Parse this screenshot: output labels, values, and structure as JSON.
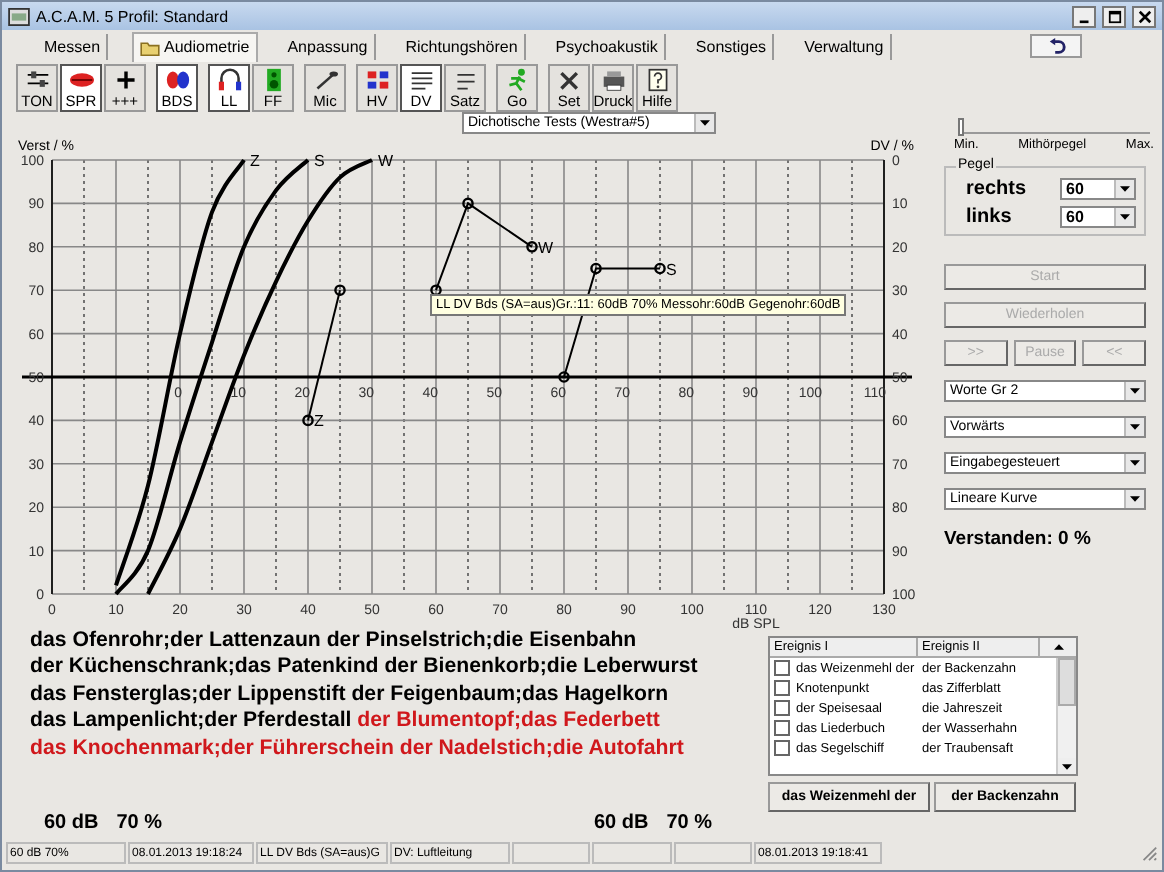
{
  "window": {
    "title": "A.C.A.M. 5  Profil: Standard"
  },
  "tabs": [
    {
      "label": "Messen",
      "selected": false,
      "has_icon": false
    },
    {
      "label": "Audiometrie",
      "selected": true,
      "has_icon": true
    },
    {
      "label": "Anpassung",
      "selected": false,
      "has_icon": false
    },
    {
      "label": "Richtungshören",
      "selected": false,
      "has_icon": false
    },
    {
      "label": "Psychoakustik",
      "selected": false,
      "has_icon": false
    },
    {
      "label": "Sonstiges",
      "selected": false,
      "has_icon": false
    },
    {
      "label": "Verwaltung",
      "selected": false,
      "has_icon": false
    }
  ],
  "toolbar": [
    [
      {
        "label": "TON",
        "selected": false
      },
      {
        "label": "SPR",
        "selected": true
      },
      {
        "label": "+++",
        "selected": false
      }
    ],
    [
      {
        "label": "BDS",
        "selected": true
      }
    ],
    [
      {
        "label": "LL",
        "selected": true
      },
      {
        "label": "FF",
        "selected": false
      }
    ],
    [
      {
        "label": "Mic",
        "selected": false
      }
    ],
    [
      {
        "label": "HV",
        "selected": false
      },
      {
        "label": "DV",
        "selected": true
      },
      {
        "label": "Satz",
        "selected": false
      }
    ],
    [
      {
        "label": "Go",
        "selected": false
      }
    ],
    [
      {
        "label": "Set",
        "selected": false
      },
      {
        "label": "Druck",
        "selected": false
      },
      {
        "label": "Hilfe",
        "selected": false
      }
    ]
  ],
  "test_select": {
    "value": "Dichotische Tests (Westra#5)"
  },
  "level_slider": {
    "level": 0,
    "labels": [
      "Min.",
      "Mithörpegel",
      "Max."
    ]
  },
  "chart": {
    "chart_data": {
      "type": "line",
      "xlabel": "dB SPL",
      "ylabel": "Verst / %",
      "x": [
        10,
        15,
        20,
        25,
        30,
        35,
        40,
        45,
        50,
        60,
        65,
        75,
        80,
        85,
        95
      ],
      "series": [
        {
          "marker": false,
          "values": [
            2,
            25,
            60,
            88,
            100,
            null,
            null,
            null,
            null,
            null,
            null,
            null,
            null,
            null,
            null
          ]
        },
        {
          "marker": false,
          "values": [
            0,
            10,
            35,
            58,
            80,
            93,
            100,
            null,
            null,
            null,
            null,
            null,
            null,
            null,
            null
          ]
        },
        {
          "marker": false,
          "values": [
            null,
            0,
            15,
            35,
            55,
            72,
            86,
            96,
            100,
            null,
            null,
            null,
            null,
            null,
            null
          ]
        },
        {
          "marker": true,
          "values": [
            null,
            null,
            null,
            null,
            null,
            null,
            40,
            70,
            null,
            null,
            null,
            null,
            null,
            null,
            null
          ]
        },
        {
          "marker": true,
          "values": [
            null,
            null,
            null,
            null,
            null,
            null,
            null,
            null,
            null,
            70,
            90,
            80,
            null,
            null,
            null
          ]
        },
        {
          "marker": true,
          "values": [
            null,
            null,
            null,
            null,
            null,
            null,
            null,
            null,
            null,
            null,
            null,
            null,
            50,
            75,
            75
          ]
        }
      ],
      "annotations": [
        {
          "text": "Z",
          "x": 30,
          "y": 100
        },
        {
          "text": "S",
          "x": 40,
          "y": 100
        },
        {
          "text": "W",
          "x": 50,
          "y": 100
        },
        {
          "text": "Z",
          "x": 40,
          "y": 40
        },
        {
          "text": "W",
          "x": 75,
          "y": 80
        },
        {
          "text": "S",
          "x": 95,
          "y": 75
        }
      ],
      "ref_lines": [
        {
          "axis": "y",
          "value": 50
        }
      ],
      "grid": true,
      "xlim": [
        0,
        130
      ],
      "ylim": [
        0,
        100
      ],
      "xticks": [
        0,
        10,
        20,
        30,
        40,
        50,
        60,
        70,
        80,
        90,
        100,
        110,
        120,
        130
      ],
      "yticks": [
        0,
        10,
        20,
        30,
        40,
        50,
        60,
        70,
        80,
        90,
        100
      ]
    },
    "hl_xticks": [
      "0",
      "10",
      "20",
      "30",
      "40",
      "50",
      "60",
      "70",
      "80",
      "90",
      "100",
      "110"
    ],
    "right_axis": {
      "label": "DV / %",
      "ticks": [
        "0",
        "10",
        "20",
        "30",
        "40",
        "50",
        "60",
        "70",
        "80",
        "90",
        "100"
      ]
    },
    "tooltip": "LL DV Bds (SA=aus)Gr.:11:  60dB  70% Messohr:60dB Gegenohr:60dB"
  },
  "pegel": {
    "title": "Pegel",
    "channels": [
      {
        "label": "rechts",
        "value": "60"
      },
      {
        "label": "links",
        "value": "60"
      }
    ]
  },
  "action_buttons": [
    {
      "label": "Start",
      "disabled": true
    },
    {
      "label": "Wiederholen",
      "disabled": true
    }
  ],
  "transport_buttons": [
    {
      "label": ">>",
      "disabled": true
    },
    {
      "label": "Pause",
      "disabled": true
    },
    {
      "label": "<<",
      "disabled": true
    }
  ],
  "selects": [
    "Worte Gr 2",
    "Vorwärts",
    "Eingabegesteuert",
    "Lineare Kurve"
  ],
  "result": "Verstanden: 0 %",
  "words": [
    [
      {
        "text": "das Ofenrohr;der Lattenzaun der Pinselstrich;die Eisenbahn",
        "highlighted": false
      }
    ],
    [
      {
        "text": "der Küchenschrank;das Patenkind der Bienenkorb;die Leberwurst",
        "highlighted": false
      }
    ],
    [
      {
        "text": "das Fensterglas;der Lippenstift der Feigenbaum;das Hagelkorn",
        "highlighted": false
      }
    ],
    [
      {
        "text": "das Lampenlicht;der Pferdestall ",
        "highlighted": false
      },
      {
        "text": "der Blumentopf;das Federbett",
        "highlighted": true
      }
    ],
    [
      {
        "text": "das Knochenmark;der Führerschein der Nadelstich;die Autofahrt",
        "highlighted": true
      }
    ]
  ],
  "events": {
    "columns": [
      "Ereignis I",
      "Ereignis II"
    ],
    "rows": [
      {
        "cells": [
          "das Weizenmehl der",
          "der Backenzahn"
        ],
        "checked": false
      },
      {
        "cells": [
          "Knotenpunkt",
          "das Zifferblatt"
        ],
        "checked": false
      },
      {
        "cells": [
          "der Speisesaal",
          "die Jahreszeit"
        ],
        "checked": false
      },
      {
        "cells": [
          "das Liederbuch",
          "der Wasserhahn"
        ],
        "checked": false
      },
      {
        "cells": [
          "das Segelschiff",
          "der Traubensaft"
        ],
        "checked": false
      }
    ]
  },
  "answer_buttons": [
    "das Weizenmehl der",
    "der Backenzahn"
  ],
  "readouts": [
    {
      "level": "60 dB",
      "score": "70 %"
    },
    {
      "level": "60 dB",
      "score": "70 %"
    }
  ],
  "status_bar": {
    "left": [
      "60 dB  70%",
      "08.01.2013 19:18:24",
      "LL DV Bds (SA=aus)G",
      "DV: Luftleitung"
    ],
    "right": [
      "08.01.2013 19:18:41"
    ]
  }
}
